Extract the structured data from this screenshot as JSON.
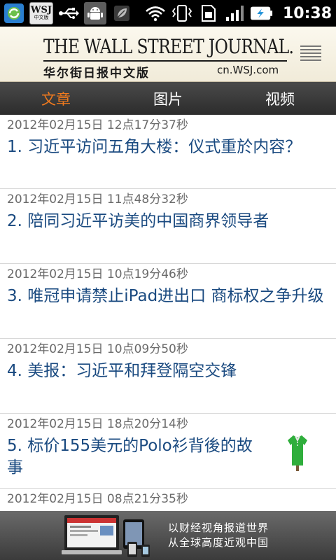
{
  "status_bar": {
    "time": "10:38",
    "wsj_badge_top": "WSJ",
    "wsj_badge_bottom": "中文版",
    "icons": [
      "sync-app-icon",
      "wsj-app-icon",
      "usb-icon",
      "android-debug-icon",
      "leaf-icon",
      "wifi-icon",
      "vibrate-icon",
      "sim-icon",
      "signal-icon",
      "battery-charging-icon"
    ]
  },
  "masthead": {
    "title": "THE WALL STREET JOURNAL.",
    "subtitle": "华尔街日报中文版",
    "url": "cn.WSJ.com"
  },
  "tabs": [
    {
      "label": "文章",
      "active": true
    },
    {
      "label": "图片",
      "active": false
    },
    {
      "label": "视频",
      "active": false
    }
  ],
  "articles": [
    {
      "timestamp": "2012年02月15日 12点17分37秒",
      "title": "1. 习近平访问五角大楼：仪式重於内容？"
    },
    {
      "timestamp": "2012年02月15日 11点48分32秒",
      "title": "2. 陪同习近平访美的中国商界领导者"
    },
    {
      "timestamp": "2012年02月15日 10点19分46秒",
      "title": "3. 唯冠申请禁止iPad进出口 商标权之争升级"
    },
    {
      "timestamp": "2012年02月15日 10点09分50秒",
      "title": "4. 美报：习近平和拜登隔空交锋"
    },
    {
      "timestamp": "2012年02月15日 18点20分14秒",
      "title": "5. 标价155美元的Polo衫背後的故事",
      "thumbnail": "green-polo-shirt-icon"
    },
    {
      "timestamp": "2012年02月15日 08点21分35秒",
      "title": ""
    }
  ],
  "ad_banner": {
    "line1": "以财经视角报道世界",
    "line2": "从全球高度近观中国"
  },
  "colors": {
    "accent_tab": "#f07a1e",
    "title_link": "#1a4a80",
    "timestamp": "#6a6a6a"
  }
}
